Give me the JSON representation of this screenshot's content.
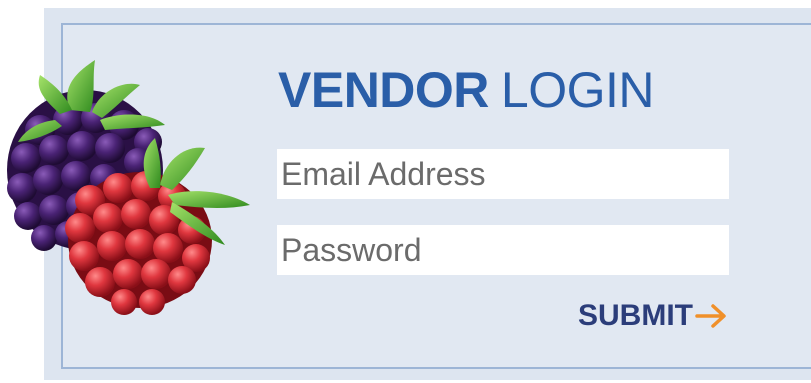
{
  "login": {
    "title_bold": "VENDOR",
    "title_light": "LOGIN",
    "email_placeholder": "Email Address",
    "password_placeholder": "Password",
    "submit_label": "SUBMIT"
  },
  "icons": {
    "berries": "berries-illustration",
    "submit_arrow": "arrow-right-icon"
  },
  "colors": {
    "title": "#2a5ea8",
    "submit": "#2b3d7a",
    "arrow": "#f0902a",
    "panel": "#dde5f0",
    "panel_border": "#9db5d6"
  }
}
